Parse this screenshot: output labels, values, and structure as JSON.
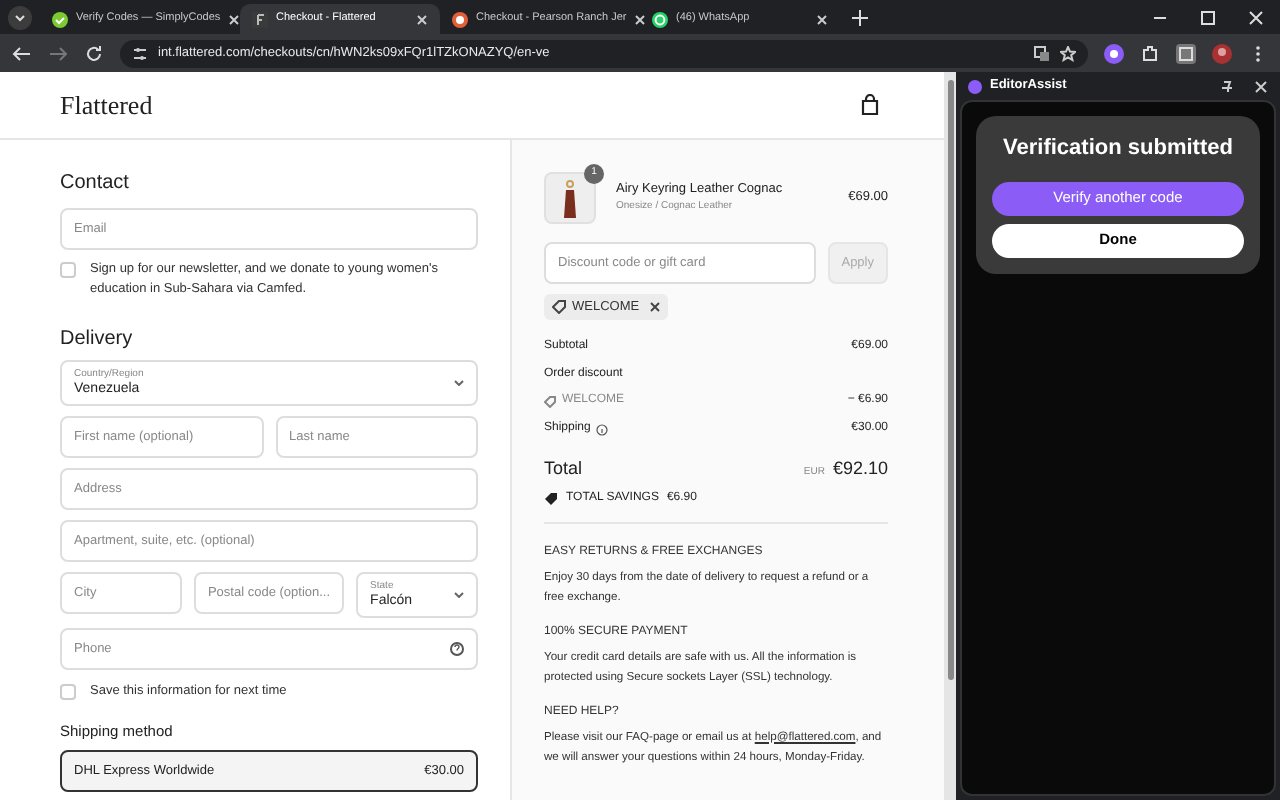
{
  "browser": {
    "tabs": [
      {
        "title": "Verify Codes — SimplyCodes",
        "selected": false,
        "kind": "check"
      },
      {
        "title": "Checkout - Flattered",
        "selected": true,
        "kind": "letter"
      },
      {
        "title": "Checkout - Pearson Ranch Jer",
        "selected": false,
        "kind": "ranch"
      },
      {
        "title": "(46) WhatsApp",
        "selected": false,
        "kind": "chat"
      }
    ],
    "address": "int.flattered.com/checkouts/cn/hWN2ks09xFQr1lTZkONAZYQ/en-ve"
  },
  "side_panel": {
    "title": "EditorAssist",
    "heading": "Verification submitted",
    "buttons": [
      {
        "label": "Verify another code",
        "kind": "primary"
      },
      {
        "label": "Done",
        "kind": "secondary"
      }
    ]
  },
  "page": {
    "logo": "Flattered",
    "contact": {
      "heading": "Contact",
      "email": {
        "placeholder": "Email"
      },
      "newsletter": {
        "label": "Sign up for our newsletter, and we donate to young women's education in Sub-Sahara via Camfed.",
        "checked": false
      }
    },
    "delivery": {
      "heading": "Delivery",
      "country": {
        "label": "Country/Region",
        "value": "Venezuela"
      },
      "first_name": {
        "placeholder": "First name (optional)"
      },
      "last_name": {
        "placeholder": "Last name"
      },
      "address": {
        "placeholder": "Address"
      },
      "apartment": {
        "placeholder": "Apartment, suite, etc. (optional)"
      },
      "city": {
        "placeholder": "City"
      },
      "postal_code": {
        "placeholder": "Postal code (option..."
      },
      "state": {
        "label": "State",
        "value": "Falcón"
      },
      "phone": {
        "placeholder": "Phone"
      },
      "save_info": {
        "label": "Save this information for next time",
        "checked": false
      }
    },
    "shipping": {
      "heading": "Shipping method",
      "options": [
        {
          "name": "DHL Express Worldwide",
          "price": "€30.00",
          "selected": true
        }
      ]
    }
  },
  "summary": {
    "item": {
      "quantity": "1",
      "name": "Airy Keyring Leather Cognac",
      "variant": "Onesize / Cognac Leather",
      "price": "€69.00"
    },
    "discount": {
      "placeholder": "Discount code or gift card",
      "button": "Apply"
    },
    "code_tag": "WELCOME",
    "subtotal": {
      "label": "Subtotal",
      "value": "€69.00"
    },
    "order_discount": {
      "label": "Order discount",
      "code": "WELCOME",
      "value": "− €6.90"
    },
    "shipping": {
      "label": "Shipping",
      "value": "€30.00"
    },
    "total": {
      "label": "Total",
      "currency": "EUR",
      "value": "€92.10"
    },
    "savings": {
      "label": "TOTAL SAVINGS",
      "value": "€6.90"
    },
    "info": [
      {
        "heading": "EASY RETURNS & FREE EXCHANGES",
        "text": "Enjoy 30 days from the date of delivery to request a refund or a free exchange."
      },
      {
        "heading": "100% SECURE PAYMENT",
        "text": "Your credit card details are safe with us. All the information is protected using Secure sockets Layer (SSL) technology."
      },
      {
        "heading": "NEED HELP?",
        "text": "Please visit our FAQ-page or email us at",
        "link": "help@flattered.com",
        "text_after": ", and we will answer your questions within 24 hours, Monday-Friday."
      }
    ]
  }
}
